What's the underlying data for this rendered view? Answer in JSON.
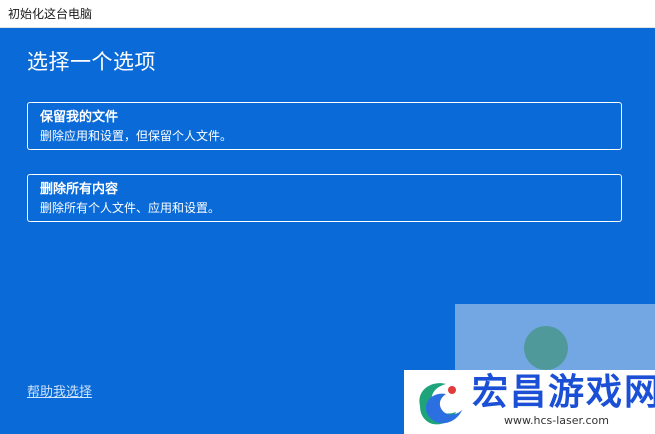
{
  "window": {
    "title": "初始化这台电脑"
  },
  "main": {
    "heading": "选择一个选项",
    "options": [
      {
        "title": "保留我的文件",
        "description": "删除应用和设置，但保留个人文件。"
      },
      {
        "title": "删除所有内容",
        "description": "删除所有个人文件、应用和设置。"
      }
    ],
    "help_link": "帮助我选择"
  },
  "watermark": {
    "name": "宏昌游戏网",
    "url": "www.hcs-laser.com"
  },
  "colors": {
    "panel_bg": "#0a6ad8",
    "watermark_text": "#1a4fd6"
  }
}
